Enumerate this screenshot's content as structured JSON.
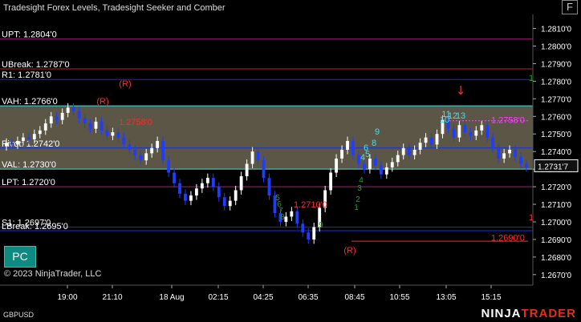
{
  "app": {
    "title": "Tradesight Forex Levels, Tradesight Seeker and Comber",
    "symbol": "GBPUSD",
    "copyright": "© 2023 NinjaTrader, LLC",
    "brand_a": "NINJA",
    "brand_b": "TRADER",
    "pc_button": "PC",
    "f_button": "F"
  },
  "colors": {
    "background": "#000000",
    "up_candle": "#ffffff",
    "down_candle": "#1f3cff",
    "value_area_fill": "#6b6552",
    "value_area_line": "#3fe0e0",
    "upt_line": "#a0207a",
    "ubreak_line": "#c01f1f",
    "r1_line": "#1a2fd0",
    "pivot_line": "#1a2fd0",
    "s1_line": "#1a2fd0",
    "lpt_line": "#a0207a",
    "red_label": "#ff2a2a",
    "magenta_label": "#ff40ff",
    "green_count": "#1fa01f",
    "cyan_count": "#3fe0f0"
  },
  "chart_data": {
    "type": "candlestick",
    "y_axis": {
      "min": 1.2664,
      "max": 1.2818,
      "ticks": [
        "1.2810'0",
        "1.2800'0",
        "1.2790'0",
        "1.2780'0",
        "1.2770'0",
        "1.2760'0",
        "1.2750'0",
        "1.2740'0",
        "1.2730'0",
        "1.2720'0",
        "1.2710'0",
        "1.2700'0",
        "1.2690'0",
        "1.2680'0",
        "1.2670'0"
      ],
      "tick_values": [
        1.281,
        1.28,
        1.279,
        1.278,
        1.277,
        1.276,
        1.275,
        1.274,
        1.273,
        1.272,
        1.271,
        1.27,
        1.269,
        1.268,
        1.267
      ],
      "last_price_label": "1.2731'7",
      "last_price": 1.27317
    },
    "x_axis": {
      "labels": [
        "19:00",
        "21:10",
        "18 Aug",
        "02:15",
        "04:25",
        "06:35",
        "08:45",
        "10:55",
        "13:05",
        "15:15"
      ]
    },
    "levels": [
      {
        "key": "upt",
        "label": "UPT: 1.2804'0",
        "value": 1.2804,
        "color": "#a0207a"
      },
      {
        "key": "ubreak",
        "label": "UBreak: 1.2787'0",
        "value": 1.2787,
        "color": "#c01f1f"
      },
      {
        "key": "r1",
        "label": "R1: 1.2781'0",
        "value": 1.2781,
        "color": "#1a2fd0"
      },
      {
        "key": "vah",
        "label": "VAH: 1.2766'0",
        "value": 1.2766,
        "color": "#3fe0e0"
      },
      {
        "key": "pivot",
        "label": "Pivot: 1.2742'0",
        "value": 1.2742,
        "color": "#1a2fd0"
      },
      {
        "key": "val",
        "label": "VAL: 1.2730'0",
        "value": 1.273,
        "color": "#3fe0e0"
      },
      {
        "key": "lpt",
        "label": "LPT: 1.2720'0",
        "value": 1.272,
        "color": "#a0207a"
      },
      {
        "key": "s1",
        "label": "S1: 1.2697'0",
        "value": 1.2697,
        "color": "#1a2fd0"
      },
      {
        "key": "lbreak",
        "label": "LBreak: 1.2695'0",
        "value": 1.2695,
        "color": "#1a2fd0"
      }
    ],
    "annotations": [
      {
        "text": "1.2758'0",
        "value": 1.2758,
        "color": "#ff40ff"
      },
      {
        "text": "1.2758'0",
        "value": 1.2757,
        "color": "#ff2a2a"
      },
      {
        "text": "1.2710'0",
        "value": 1.271,
        "color": "#ff2a2a"
      },
      {
        "text": "1.2690'0",
        "value": 1.2691,
        "color": "#ff2a2a"
      },
      {
        "text": "(R)",
        "color": "#ff2a2a"
      },
      {
        "text": "(R)",
        "color": "#ff2a2a"
      },
      {
        "text": "(R)",
        "color": "#ff2a2a"
      },
      {
        "text": "1",
        "color": "#1fa01f"
      },
      {
        "text": "1",
        "color": "#ff2a2a"
      }
    ],
    "counts_cyan": [
      "10",
      "11",
      "12",
      "13",
      "9",
      "8",
      "6",
      "5",
      "4"
    ],
    "counts_green": [
      "1",
      "2",
      "3",
      "4",
      "5",
      "6",
      "7",
      "8",
      "9"
    ],
    "closes": [
      1.2745,
      1.2744,
      1.2746,
      1.2748,
      1.2747,
      1.275,
      1.2752,
      1.2756,
      1.276,
      1.2758,
      1.2762,
      1.2765,
      1.2763,
      1.2759,
      1.2756,
      1.2753,
      1.2757,
      1.2752,
      1.2749,
      1.2751,
      1.2748,
      1.2744,
      1.2741,
      1.2738,
      1.2735,
      1.2739,
      1.2742,
      1.2746,
      1.2735,
      1.2728,
      1.2722,
      1.2716,
      1.2712,
      1.2715,
      1.2719,
      1.2722,
      1.2725,
      1.272,
      1.2714,
      1.2709,
      1.2712,
      1.2718,
      1.2726,
      1.2733,
      1.274,
      1.2735,
      1.2725,
      1.2715,
      1.2705,
      1.27,
      1.2703,
      1.2706,
      1.2699,
      1.2694,
      1.269,
      1.2697,
      1.2708,
      1.2718,
      1.2728,
      1.2736,
      1.2741,
      1.2746,
      1.2738,
      1.2733,
      1.273,
      1.2736,
      1.2732,
      1.2727,
      1.2731,
      1.2734,
      1.2738,
      1.2742,
      1.2738,
      1.2741,
      1.2745,
      1.2748,
      1.2744,
      1.275,
      1.2758,
      1.2753,
      1.2748,
      1.2755,
      1.2751,
      1.2749,
      1.2752,
      1.2755,
      1.2748,
      1.2742,
      1.2736,
      1.2739,
      1.2741,
      1.2737,
      1.2733,
      1.2731
    ]
  }
}
